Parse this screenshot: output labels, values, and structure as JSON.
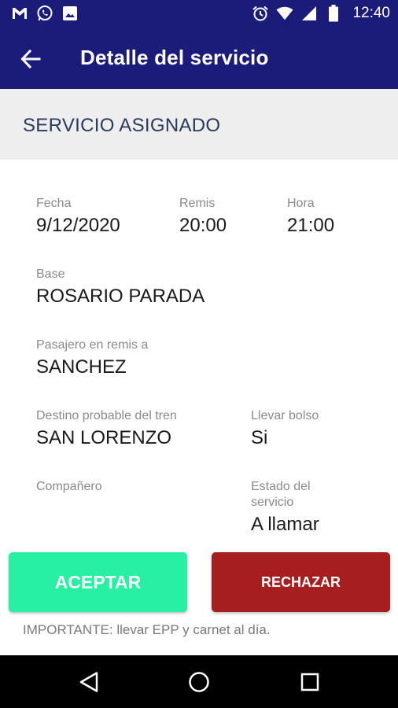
{
  "status_bar": {
    "time": "12:40",
    "left_icons": [
      "gmail-icon",
      "whatsapp-icon",
      "image-icon"
    ],
    "right_icons": [
      "alarm-icon",
      "wifi-icon",
      "signal-icon",
      "battery-icon"
    ]
  },
  "app_bar": {
    "title": "Detalle del servicio",
    "back_icon": "arrow-back-icon"
  },
  "section": {
    "title": "SERVICIO ASIGNADO"
  },
  "fields": {
    "fecha": {
      "label": "Fecha",
      "value": "9/12/2020"
    },
    "remis": {
      "label": "Remis",
      "value": "20:00"
    },
    "hora": {
      "label": "Hora",
      "value": "21:00"
    },
    "base": {
      "label": "Base",
      "value": "ROSARIO PARADA"
    },
    "pasajero": {
      "label": "Pasajero en remis a",
      "value": "SANCHEZ"
    },
    "destino": {
      "label": "Destino probable del tren",
      "value": "SAN LORENZO"
    },
    "bolso": {
      "label": "Llevar bolso",
      "value": "Si"
    },
    "companero": {
      "label": "Compañero",
      "value": ""
    },
    "estado": {
      "label_line1": "Estado del",
      "label_line2": "servicio",
      "value": "A llamar"
    }
  },
  "buttons": {
    "accept_label": "ACEPTAR",
    "reject_label": "RECHAZAR"
  },
  "note": "IMPORTANTE: llevar EPP y carnet al día.",
  "colors": {
    "primary": "#1b1b7a",
    "accept": "#27f0a2",
    "reject": "#a61e1e",
    "section_bg": "#eeeeee"
  },
  "nav_bar": {
    "icons": [
      "back-triangle-icon",
      "home-circle-icon",
      "recents-square-icon"
    ]
  }
}
